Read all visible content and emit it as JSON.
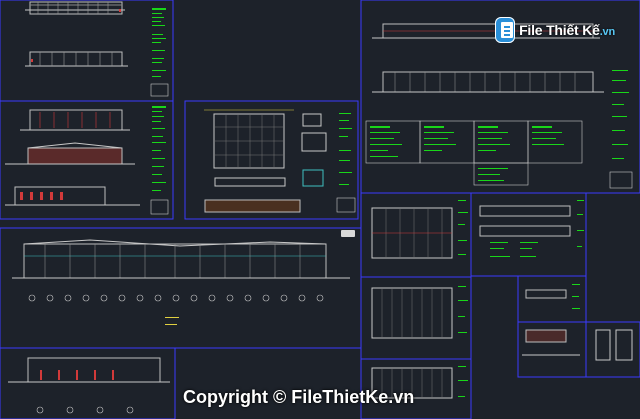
{
  "watermark": {
    "brand_name": "File Thiết Kế",
    "brand_tld": ".vn",
    "copyright": "Copyright © FileThietKe.vn"
  },
  "colors": {
    "background": "#1d222a",
    "frame": "#3a3aff",
    "drawing_lines": "#c8c8c8",
    "annotation_green": "#19d619",
    "accent_red": "#d23a3a",
    "accent_yellow": "#e0d040",
    "accent_cyan": "#3fc0c0"
  },
  "icons": [
    "document-icon"
  ]
}
